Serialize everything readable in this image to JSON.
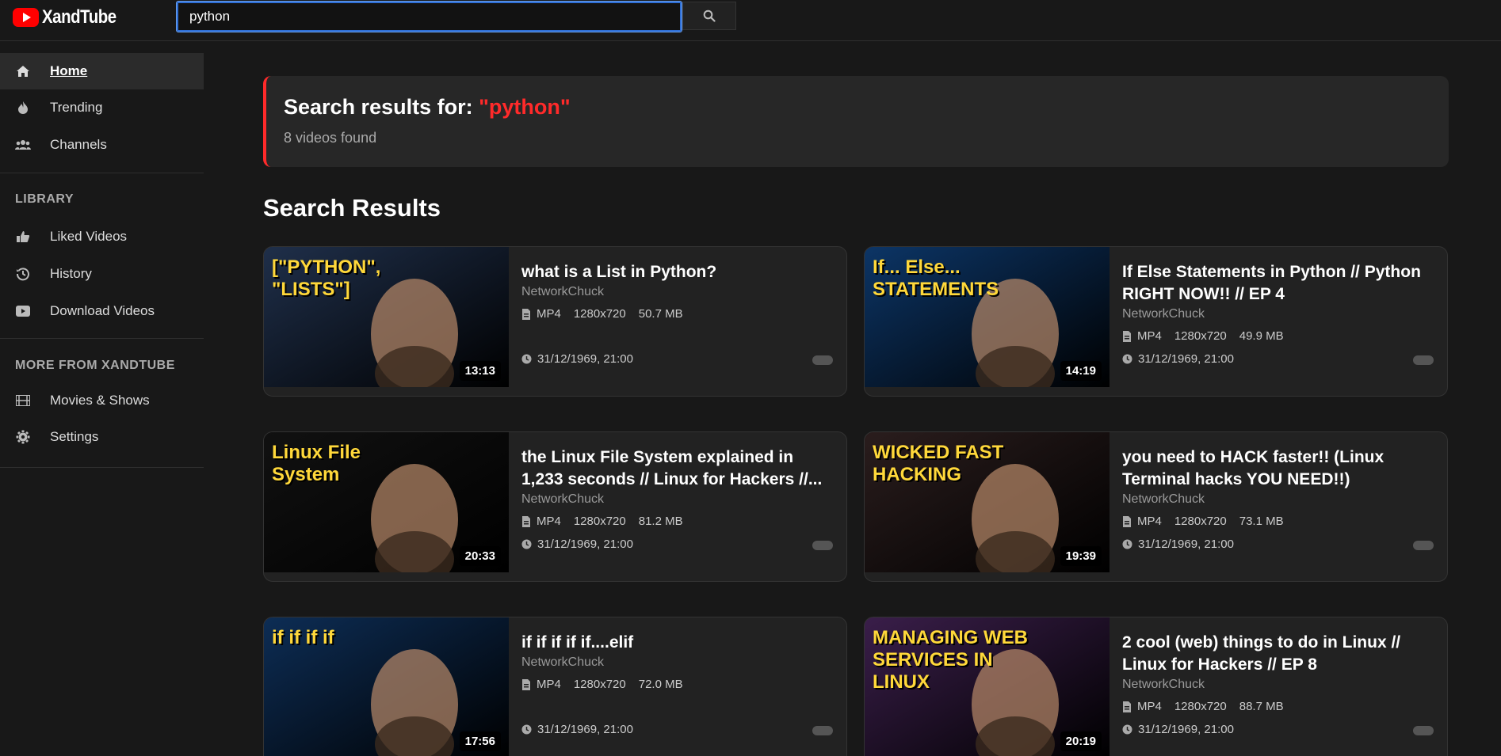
{
  "app": {
    "name": "XandTube"
  },
  "search": {
    "value": "python",
    "button_label": ""
  },
  "sidebar": {
    "items": [
      {
        "label": "Home",
        "icon": "home-icon"
      },
      {
        "label": "Trending",
        "icon": "flame-icon"
      },
      {
        "label": "Channels",
        "icon": "users-icon"
      }
    ],
    "library_title": "LIBRARY",
    "library_items": [
      {
        "label": "Liked Videos",
        "icon": "thumbs-up-icon"
      },
      {
        "label": "History",
        "icon": "history-icon"
      },
      {
        "label": "Download Videos",
        "icon": "video-icon"
      }
    ],
    "more_title": "MORE FROM XANDTUBE",
    "more_items": [
      {
        "label": "Movies & Shows",
        "icon": "film-icon"
      },
      {
        "label": "Settings",
        "icon": "gear-icon"
      }
    ]
  },
  "banner": {
    "prefix": "Search results for: ",
    "query": "\"python\"",
    "count": "8 videos found"
  },
  "results_heading": "Search Results",
  "videos": [
    {
      "title": "what is a List in Python?",
      "channel": "NetworkChuck",
      "format": "MP4",
      "resolution": "1280x720",
      "size": "50.7 MB",
      "date": "31/12/1969, 21:00",
      "duration": "13:13",
      "thumb_color": "#1f2f4a",
      "thumb_text": "[\"PYTHON\", \"LISTS\"]"
    },
    {
      "title": "If Else Statements in Python // Python RIGHT NOW!! // EP 4",
      "channel": "NetworkChuck",
      "format": "MP4",
      "resolution": "1280x720",
      "size": "49.9 MB",
      "date": "31/12/1969, 21:00",
      "duration": "14:19",
      "thumb_color": "#0c3566",
      "thumb_text": "If... Else... STATEMENTS"
    },
    {
      "title": "the Linux File System explained in 1,233 seconds // Linux for Hackers //...",
      "channel": "NetworkChuck",
      "format": "MP4",
      "resolution": "1280x720",
      "size": "81.2 MB",
      "date": "31/12/1969, 21:00",
      "duration": "20:33",
      "thumb_color": "#111111",
      "thumb_text": "Linux File System"
    },
    {
      "title": "you need to HACK faster!! (Linux Terminal hacks YOU NEED!!)",
      "channel": "NetworkChuck",
      "format": "MP4",
      "resolution": "1280x720",
      "size": "73.1 MB",
      "date": "31/12/1969, 21:00",
      "duration": "19:39",
      "thumb_color": "#2a1d1d",
      "thumb_text": "WICKED FAST HACKING"
    },
    {
      "title": "if if if if if....elif",
      "channel": "NetworkChuck",
      "format": "MP4",
      "resolution": "1280x720",
      "size": "72.0 MB",
      "date": "31/12/1969, 21:00",
      "duration": "17:56",
      "thumb_color": "#0d2d55",
      "thumb_text": "if if if if"
    },
    {
      "title": "2 cool (web) things to do in Linux // Linux for Hackers // EP 8",
      "channel": "NetworkChuck",
      "format": "MP4",
      "resolution": "1280x720",
      "size": "88.7 MB",
      "date": "31/12/1969, 21:00",
      "duration": "20:19",
      "thumb_color": "#3a1e4a",
      "thumb_text": "MANAGING WEB SERVICES IN LINUX"
    }
  ],
  "colors": {
    "accent": "#ff2a2a",
    "background": "#181818",
    "card": "#222222",
    "focus": "#2f6fd6"
  }
}
